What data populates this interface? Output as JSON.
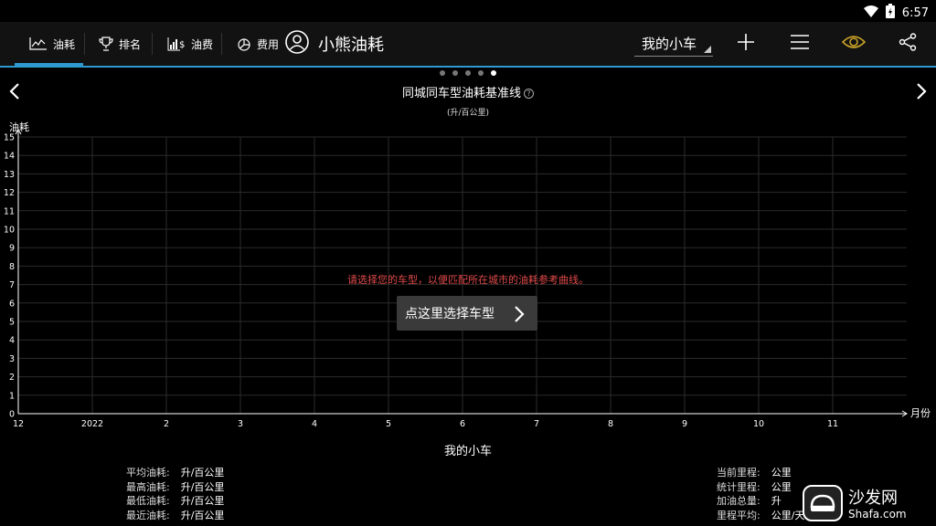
{
  "status": {
    "time": "6:57"
  },
  "tabs": [
    {
      "label": "油耗",
      "icon": "line-chart-icon",
      "active": true
    },
    {
      "label": "排名",
      "icon": "trophy-icon",
      "active": false
    },
    {
      "label": "油费",
      "icon": "bar-dollar-icon",
      "active": false
    },
    {
      "label": "费用",
      "icon": "pie-chart-icon",
      "active": false
    }
  ],
  "app": {
    "title": "小熊油耗"
  },
  "car_select": {
    "value": "我的小车"
  },
  "accent_color": "#2e9ad0",
  "carousel": {
    "count": 5,
    "active": 4
  },
  "chart": {
    "title": "同城同车型油耗基准线",
    "help": "?",
    "unit": "(升/百公里)"
  },
  "chart_data": {
    "type": "line",
    "ylabel": "油耗",
    "xlabel": "月份",
    "ylim": [
      0,
      15
    ],
    "yticks": [
      "0",
      "1",
      "2",
      "3",
      "4",
      "5",
      "6",
      "7",
      "8",
      "9",
      "10",
      "11",
      "12",
      "13",
      "14",
      "15"
    ],
    "x": [
      "12",
      "2022",
      "2",
      "3",
      "4",
      "5",
      "6",
      "7",
      "8",
      "9",
      "10",
      "11"
    ],
    "series": [],
    "grid": true
  },
  "prompt": {
    "message": "请选择您的车型，以便匹配所在城市的油耗参考曲线。",
    "button": "点这里选择车型"
  },
  "summary": {
    "title": "我的小车",
    "left": [
      {
        "label": "平均油耗:",
        "value": "升/百公里"
      },
      {
        "label": "最高油耗:",
        "value": "升/百公里"
      },
      {
        "label": "最低油耗:",
        "value": "升/百公里"
      },
      {
        "label": "最近油耗:",
        "value": "升/百公里"
      }
    ],
    "right": [
      {
        "label": "当前里程:",
        "value": "公里"
      },
      {
        "label": "统计里程:",
        "value": "公里"
      },
      {
        "label": "加油总量:",
        "value": "升"
      },
      {
        "label": "里程平均:",
        "value": "公里/天"
      }
    ]
  },
  "watermark": {
    "text": "沙发网",
    "url": "Shafa.com"
  }
}
